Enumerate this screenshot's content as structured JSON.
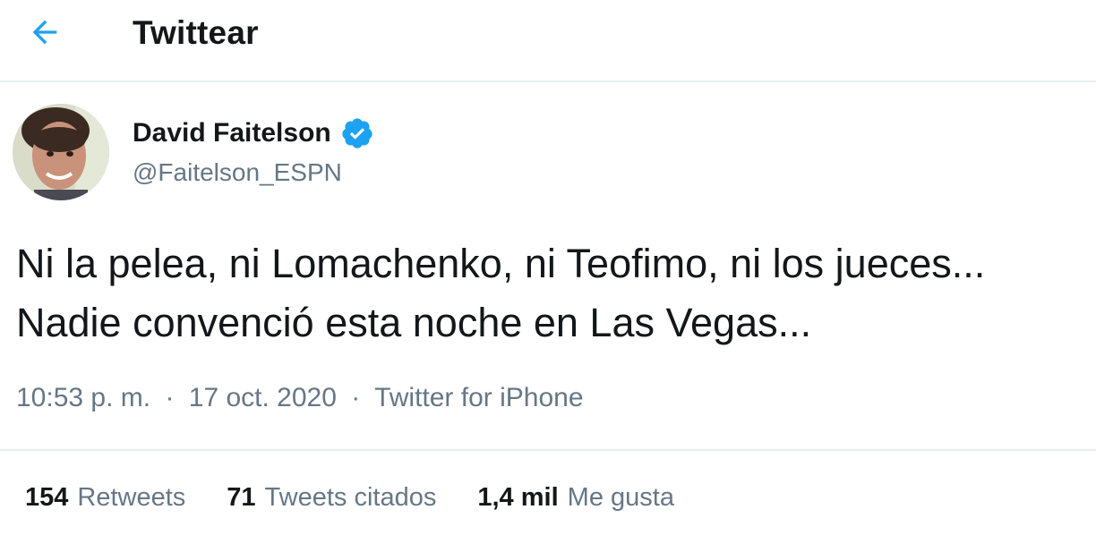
{
  "header": {
    "title": "Twittear",
    "back_icon": "arrow-left-icon",
    "accent_color": "#1da1f2"
  },
  "author": {
    "name": "David Faitelson",
    "handle": "@Faitelson_ESPN",
    "verified_icon": "verified-badge-icon"
  },
  "tweet": {
    "lines": [
      "Ni la pelea, ni Lomachenko, ni Teofimo, ni los jueces...",
      "Nadie convenció esta noche en Las Vegas..."
    ],
    "time": "10:53 p. m.",
    "separator": "·",
    "date": "17 oct. 2020",
    "source": "Twitter for iPhone"
  },
  "stats": [
    {
      "count": "154",
      "label": "Retweets"
    },
    {
      "count": "71",
      "label": "Tweets citados"
    },
    {
      "count": "1,4 mil",
      "label": "Me gusta"
    }
  ]
}
